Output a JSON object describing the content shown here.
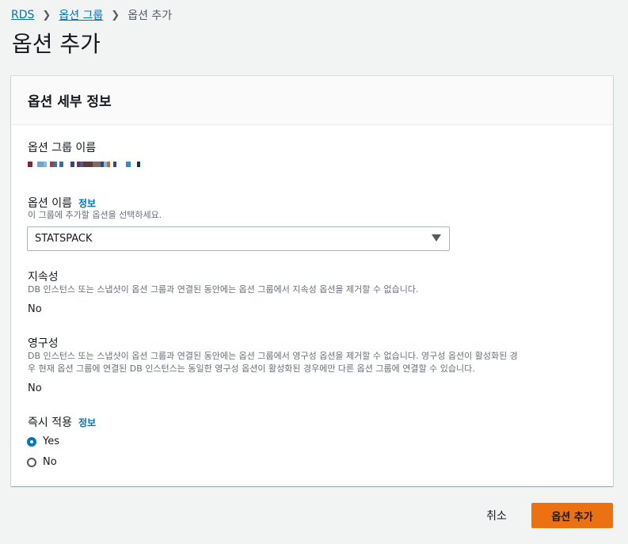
{
  "breadcrumb": {
    "root": "RDS",
    "group": "옵션 그룹",
    "current": "옵션 추가"
  },
  "page_title": "옵션 추가",
  "panel": {
    "title": "옵션 세부 정보",
    "option_group_name_label": "옵션 그룹 이름",
    "option_name": {
      "label": "옵션 이름",
      "info": "정보",
      "description": "이 그룹에 추가할 옵션을 선택하세요.",
      "selected": "STATSPACK"
    },
    "persistent": {
      "label": "지속성",
      "description": "DB 인스턴스 또는 스냅샷이 옵션 그룹과 연결된 동안에는 옵션 그룹에서 지속성 옵션을 제거할 수 없습니다.",
      "value": "No"
    },
    "permanent": {
      "label": "영구성",
      "description_line1": "DB 인스턴스 또는 스냅샷이 옵션 그룹과 연결된 동안에는 옵션 그룹에서 영구성 옵션을 제거할 수 없습니다. 영구성 옵션이 활성화된 경",
      "description_line2": "우 현재 옵션 그룹에 연결된 DB 인스턴스는 동일한 영구성 옵션이 활성화된 경우에만 다른 옵션 그룹에 연결할 수 있습니다.",
      "value": "No"
    },
    "apply_immediately": {
      "label": "즉시 적용",
      "info": "정보",
      "options": [
        "Yes",
        "No"
      ],
      "selected": "Yes"
    }
  },
  "footer": {
    "cancel": "취소",
    "submit": "옵션 추가"
  },
  "colors": {
    "link": "#0073bb",
    "primary_button": "#ec7211"
  }
}
